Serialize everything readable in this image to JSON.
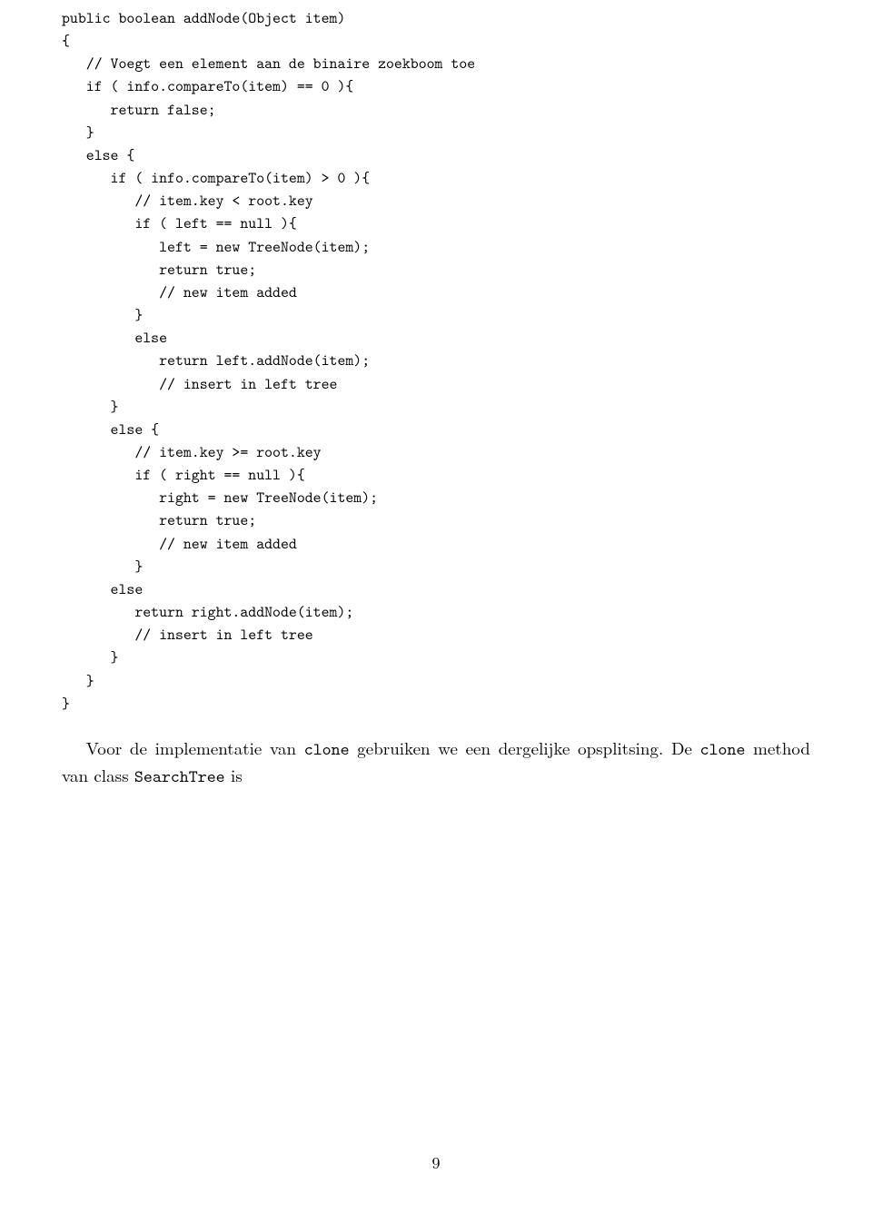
{
  "code": {
    "l01": "public boolean addNode(Object item)",
    "l02": "{",
    "l03": "   // Voegt een element aan de binaire zoekboom toe",
    "l04": "   if ( info.compareTo(item) == 0 ){",
    "l05": "      return false;",
    "l06": "   }",
    "l07": "   else {",
    "l08": "      if ( info.compareTo(item) > 0 ){",
    "l09": "         // item.key < root.key",
    "l10": "         if ( left == null ){",
    "l11": "            left = new TreeNode(item);",
    "l12": "            return true;",
    "l13": "            // new item added",
    "l14": "         }",
    "l15": "         else",
    "l16": "            return left.addNode(item);",
    "l17": "            // insert in left tree",
    "l18": "      }",
    "l19": "      else {",
    "l20": "         // item.key >= root.key",
    "l21": "         if ( right == null ){",
    "l22": "            right = new TreeNode(item);",
    "l23": "            return true;",
    "l24": "            // new item added",
    "l25": "         }",
    "l26": "      else",
    "l27": "         return right.addNode(item);",
    "l28": "         // insert in left tree",
    "l29": "      }",
    "l30": "   }",
    "l31": "}"
  },
  "paragraph": {
    "pre1": "Voor de implementatie van ",
    "tt1": "clone",
    "mid1": " gebruiken we een dergelijke opsplitsing. De ",
    "tt2": "clone",
    "post1": " method van class ",
    "tt3": "SearchTree",
    "end": " is"
  },
  "page_number": "9"
}
